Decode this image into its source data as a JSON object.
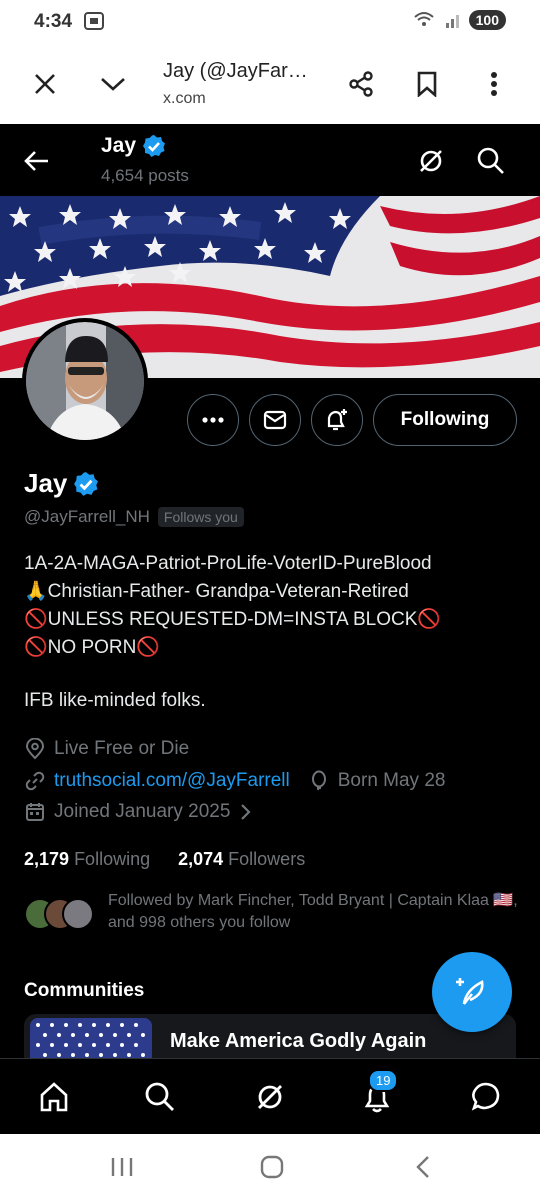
{
  "status_bar": {
    "time": "4:34",
    "battery": "100",
    "icons": [
      "screenshot-icon",
      "wifi-icon",
      "signal-icon"
    ]
  },
  "browser": {
    "title": "Jay (@JayFar…",
    "url": "x.com",
    "icons": [
      "close-icon",
      "chevron-down-icon",
      "share-icon",
      "bookmark-icon",
      "more-vertical-icon"
    ]
  },
  "header": {
    "name": "Jay",
    "posts": "4,654 posts",
    "icons": [
      "back-arrow-icon",
      "grok-icon",
      "search-icon"
    ]
  },
  "profile": {
    "name": "Jay",
    "handle": "@JayFarrell_NH",
    "follows_you": "Follows you",
    "following_button": "Following",
    "bio_lines": [
      "1A-2A-MAGA-Patriot-ProLife-VoterID-PureBlood",
      "🙏Christian-Father- Grandpa-Veteran-Retired",
      "UNLESS REQUESTED-DM=INSTA BLOCK",
      "NO PORN"
    ],
    "bio_extra": "IFB like-minded folks.",
    "location": "Live Free or Die",
    "website": "truthsocial.com/@JayFarrell",
    "birthday": "Born May 28",
    "joined": "Joined January 2025",
    "following_count": "2,179",
    "following_label": "Following",
    "followers_count": "2,074",
    "followers_label": "Followers",
    "followed_by": "Followed by Mark Fincher, Todd Bryant | Captain Klaa 🇺🇸, and 998 others you follow"
  },
  "communities": {
    "title": "Communities",
    "items": [
      {
        "name": "Make America Godly Again"
      }
    ]
  },
  "nav": {
    "notifications_badge": "19",
    "icons": [
      "home-icon",
      "search-icon",
      "grok-icon",
      "notifications-icon",
      "messages-icon"
    ]
  },
  "colors": {
    "accent": "#1d9bf0",
    "background": "#000000",
    "muted": "#71767b",
    "ban": "#e0245e"
  }
}
